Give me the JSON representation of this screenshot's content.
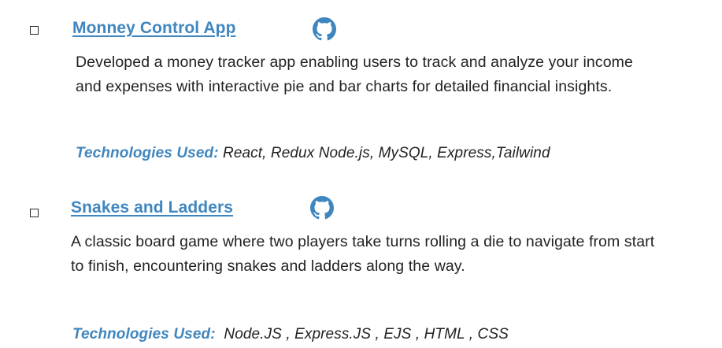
{
  "projects": [
    {
      "title": "Monney Control App",
      "icon": "github-icon",
      "description": "Developed a money tracker app enabling users to track and analyze your income and expenses with interactive pie and bar charts for detailed financial insights.",
      "tech_label": "Technologies Used:",
      "tech_list": " React, Redux Node.js, MySQL, Express,Tailwind"
    },
    {
      "title": "Snakes and Ladders",
      "icon": "github-icon",
      "description": "A classic board game where two players take turns rolling a die to navigate from start to finish, encountering snakes and ladders along the way.",
      "tech_label": "Technologies Used:",
      "tech_list": "  Node.JS , Express.JS , EJS , HTML , CSS"
    }
  ],
  "colors": {
    "accent": "#3f86bf",
    "text": "#222222",
    "icon": "#3f86bf"
  }
}
